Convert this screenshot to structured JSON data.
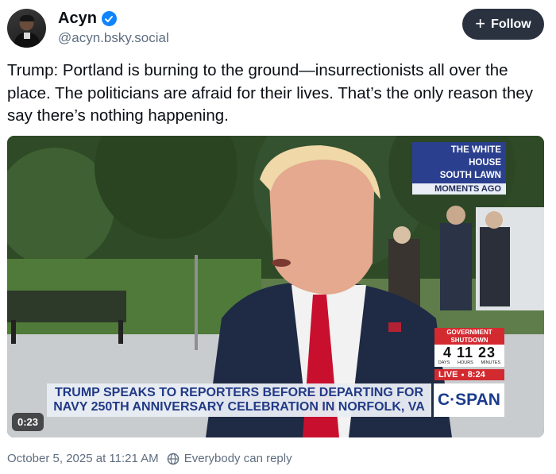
{
  "author": {
    "display_name": "Acyn",
    "handle": "@acyn.bsky.social",
    "avatar_icon": "avatar-photo",
    "verified_icon": "verified-check-icon"
  },
  "follow_button": {
    "label": "Follow",
    "icon": "plus-icon"
  },
  "post": {
    "text": "Trump: Portland is burning to the ground—insurrectionists all over the place. The politicians are afraid for their lives. That’s the only reason they say there’s nothing happening."
  },
  "video": {
    "location_line1": "THE WHITE HOUSE",
    "location_line2": "SOUTH LAWN",
    "location_sub": "MOMENTS AGO",
    "shutdown_label": "GOVERNMENT SHUTDOWN",
    "shutdown_days": "4",
    "shutdown_hours": "11",
    "shutdown_minutes": "23",
    "unit_days": "DAYS",
    "unit_hours": "HOURS",
    "unit_minutes": "MINUTES",
    "live_label": "LIVE",
    "live_time": "8:24",
    "chyron_line1": "TRUMP SPEAKS TO REPORTERS BEFORE DEPARTING FOR",
    "chyron_line2": "NAVY 250TH ANNIVERSARY CELEBRATION IN NORFOLK, VA",
    "network_logo": "C·SPAN",
    "duration": "0:23"
  },
  "footer": {
    "timestamp": "October 5, 2025 at 11:21 AM",
    "reply_setting": "Everybody can reply",
    "reply_icon": "globe-icon"
  }
}
